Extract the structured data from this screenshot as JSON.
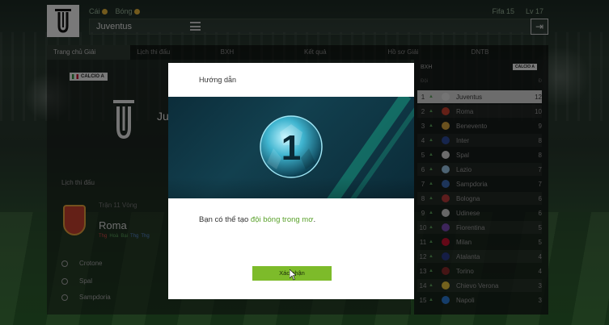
{
  "topbar": {
    "club_name": "Juventus",
    "currency_left_1": "Cái",
    "currency_left_2": "Bóng",
    "currency_right_1": "Fifa 15",
    "currency_right_2": "Lv 17"
  },
  "tabs": [
    {
      "label": "Trang chủ Giải"
    },
    {
      "label": "Lịch thi đấu"
    },
    {
      "label": "BXH"
    },
    {
      "label": "Kết quả"
    },
    {
      "label": "Hồ sơ Giải"
    },
    {
      "label": "DNTB"
    }
  ],
  "left_panel": {
    "calcio_badge": "CALCIO A",
    "club_name_short": "Ju",
    "schedule_title": "Lịch thi đấu",
    "opponent_date": "Trận 11 Vòng",
    "opponent_name": "Roma",
    "form": [
      "Thg",
      "Hoà",
      "Bại",
      "Thg",
      "Thg"
    ],
    "fixtures": [
      "Crotone",
      "Spal",
      "Sampdoria"
    ]
  },
  "standings": {
    "header": "BXH",
    "badge": "CALCIO A",
    "col_team": "Đội",
    "col_pts": "Đ",
    "rows": [
      {
        "pos": "1",
        "team": "Juventus",
        "pts": "12",
        "color": "#e8e8e8"
      },
      {
        "pos": "2",
        "team": "Roma",
        "pts": "10",
        "color": "#c8402e"
      },
      {
        "pos": "3",
        "team": "Benevento",
        "pts": "9",
        "color": "#d4a23c"
      },
      {
        "pos": "4",
        "team": "Inter",
        "pts": "8",
        "color": "#2c4a9a"
      },
      {
        "pos": "5",
        "team": "Spal",
        "pts": "8",
        "color": "#d8d8d8"
      },
      {
        "pos": "6",
        "team": "Lazio",
        "pts": "7",
        "color": "#9ac7e6"
      },
      {
        "pos": "7",
        "team": "Sampdoria",
        "pts": "7",
        "color": "#3a6ab5"
      },
      {
        "pos": "8",
        "team": "Bologna",
        "pts": "6",
        "color": "#b83a3a"
      },
      {
        "pos": "9",
        "team": "Udinese",
        "pts": "6",
        "color": "#cccccc"
      },
      {
        "pos": "10",
        "team": "Fiorentina",
        "pts": "5",
        "color": "#7a4ab5"
      },
      {
        "pos": "11",
        "team": "Milan",
        "pts": "5",
        "color": "#c8102e"
      },
      {
        "pos": "12",
        "team": "Atalanta",
        "pts": "4",
        "color": "#2a3a8a"
      },
      {
        "pos": "13",
        "team": "Torino",
        "pts": "4",
        "color": "#8a2a2a"
      },
      {
        "pos": "14",
        "team": "Chievo Verona",
        "pts": "3",
        "color": "#e6c23a"
      },
      {
        "pos": "15",
        "team": "Napoli",
        "pts": "3",
        "color": "#2a7ad5"
      }
    ]
  },
  "modal": {
    "title": "Hướng dẫn",
    "text_prefix": "Bạn có thể tạo ",
    "text_highlight": "đội bóng trong mơ",
    "text_suffix": ".",
    "badge_number": "1",
    "confirm_label": "Xác nhận"
  },
  "colors": {
    "accent_green": "#7dbb2a",
    "highlight_text_green": "#5aa12b",
    "banner_teal": "#12404f"
  }
}
